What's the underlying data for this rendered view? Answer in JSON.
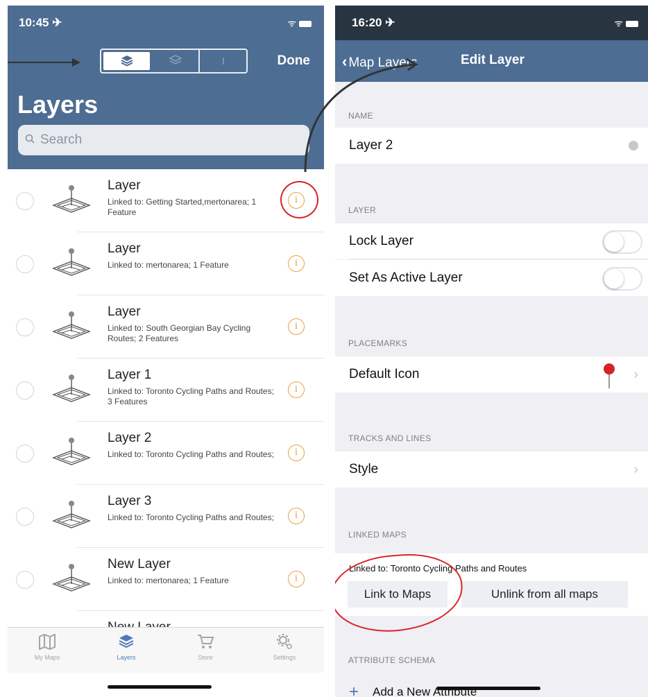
{
  "left": {
    "status": {
      "time": "10:45 ✈",
      "signal": "ᯤ"
    },
    "nav": {
      "done_label": "Done",
      "segments": [
        "layers-stack",
        "layers-stack-outline",
        "info-outline"
      ]
    },
    "title": "Layers",
    "search": {
      "placeholder": "Search"
    },
    "rows": [
      {
        "name": "Layer",
        "desc": "Linked to: Getting Started,mertonarea; 1 Feature"
      },
      {
        "name": "Layer",
        "desc": "Linked to: mertonarea; 1 Feature"
      },
      {
        "name": "Layer",
        "desc": "Linked to: South Georgian Bay Cycling Routes; 2 Features"
      },
      {
        "name": "Layer 1",
        "desc": "Linked to: Toronto Cycling Paths and Routes; 3 Features"
      },
      {
        "name": "Layer 2",
        "desc": "Linked to: Toronto Cycling Paths and Routes;"
      },
      {
        "name": "Layer 3",
        "desc": "Linked to: Toronto Cycling Paths and Routes;"
      },
      {
        "name": "New Layer",
        "desc": "Linked to: mertonarea; 1 Feature"
      },
      {
        "name": "New Layer",
        "desc": ""
      }
    ],
    "info_glyph": "i",
    "tabs": [
      {
        "label": "My Maps",
        "icon": "map-icon"
      },
      {
        "label": "Layers",
        "icon": "layers-icon"
      },
      {
        "label": "Store",
        "icon": "cart-icon"
      },
      {
        "label": "Settings",
        "icon": "gear-icon"
      }
    ]
  },
  "right": {
    "status": {
      "time": "16:20 ✈",
      "signal": "ᯤ"
    },
    "nav": {
      "back_label": "Map Layers",
      "title": "Edit Layer"
    },
    "sections": {
      "name": "NAME",
      "layer": "LAYER",
      "placemarks": "PLACEMARKS",
      "tracks": "TRACKS AND LINES",
      "linked": "LINKED MAPS",
      "attributes": "ATTRIBUTE SCHEMA"
    },
    "name_value": "Layer 2",
    "lock_layer": {
      "label": "Lock Layer",
      "on": false
    },
    "active_layer": {
      "label": "Set As Active Layer",
      "on": false
    },
    "default_icon": "Default Icon",
    "style": "Style",
    "linked_text": "Linked to: Toronto Cycling Paths and Routes",
    "link_btn": "Link to Maps",
    "unlink_btn": "Unlink from all maps",
    "add_attribute": "Add a New Attribute"
  },
  "colors": {
    "nav_blue": "#4d6d92",
    "accent_orange": "#e8a23c",
    "annotation_red": "#d8232a",
    "tint_blue": "#4d7ab7"
  }
}
